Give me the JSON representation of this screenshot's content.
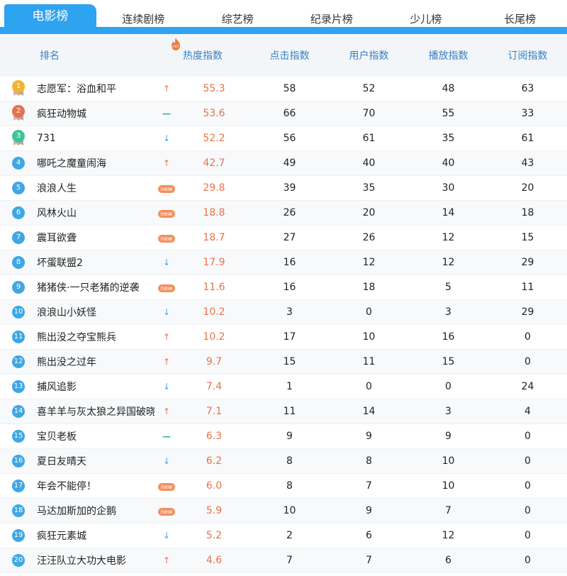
{
  "tabs": [
    {
      "label": "电影榜",
      "active": true
    },
    {
      "label": "连续剧榜",
      "active": false
    },
    {
      "label": "综艺榜",
      "active": false
    },
    {
      "label": "纪录片榜",
      "active": false
    },
    {
      "label": "少儿榜",
      "active": false
    },
    {
      "label": "长尾榜",
      "active": false
    }
  ],
  "header": {
    "rank": "排名",
    "hot_badge": "HOT",
    "heat": "热度指数",
    "click": "点击指数",
    "user": "用户指数",
    "play": "播放指数",
    "subscribe": "订阅指数"
  },
  "new_label": "new",
  "colors": {
    "accent": "#2ea3f0",
    "heat": "#e8734a",
    "badge": "#3fa7e4",
    "gold": "#f2b233",
    "silver_red": "#e8704f",
    "bronze_green": "#3fc39a"
  },
  "rows": [
    {
      "rank": "1",
      "name": "志愿军：浴血和平",
      "trend": "up",
      "heat": "55.3",
      "click": "58",
      "user": "52",
      "play": "48",
      "subscribe": "63"
    },
    {
      "rank": "2",
      "name": "疯狂动物城",
      "trend": "flat",
      "heat": "53.6",
      "click": "66",
      "user": "70",
      "play": "55",
      "subscribe": "33"
    },
    {
      "rank": "3",
      "name": "731",
      "trend": "down",
      "heat": "52.2",
      "click": "56",
      "user": "61",
      "play": "35",
      "subscribe": "61"
    },
    {
      "rank": "4",
      "name": "哪吒之魔童闹海",
      "trend": "up",
      "heat": "42.7",
      "click": "49",
      "user": "40",
      "play": "40",
      "subscribe": "43"
    },
    {
      "rank": "5",
      "name": "浪浪人生",
      "trend": "new",
      "heat": "29.8",
      "click": "39",
      "user": "35",
      "play": "30",
      "subscribe": "20"
    },
    {
      "rank": "6",
      "name": "风林火山",
      "trend": "new",
      "heat": "18.8",
      "click": "26",
      "user": "20",
      "play": "14",
      "subscribe": "18"
    },
    {
      "rank": "7",
      "name": "震耳欲聋",
      "trend": "new",
      "heat": "18.7",
      "click": "27",
      "user": "26",
      "play": "12",
      "subscribe": "15"
    },
    {
      "rank": "8",
      "name": "坏蛋联盟2",
      "trend": "down",
      "heat": "17.9",
      "click": "16",
      "user": "12",
      "play": "12",
      "subscribe": "29"
    },
    {
      "rank": "9",
      "name": "猪猪侠·一只老猪的逆袭",
      "trend": "new",
      "heat": "11.6",
      "click": "16",
      "user": "18",
      "play": "5",
      "subscribe": "11"
    },
    {
      "rank": "10",
      "name": "浪浪山小妖怪",
      "trend": "down",
      "heat": "10.2",
      "click": "3",
      "user": "0",
      "play": "3",
      "subscribe": "29"
    },
    {
      "rank": "11",
      "name": "熊出没之夺宝熊兵",
      "trend": "up",
      "heat": "10.2",
      "click": "17",
      "user": "10",
      "play": "16",
      "subscribe": "0"
    },
    {
      "rank": "12",
      "name": "熊出没之过年",
      "trend": "up",
      "heat": "9.7",
      "click": "15",
      "user": "11",
      "play": "15",
      "subscribe": "0"
    },
    {
      "rank": "13",
      "name": "捕风追影",
      "trend": "down",
      "heat": "7.4",
      "click": "1",
      "user": "0",
      "play": "0",
      "subscribe": "24"
    },
    {
      "rank": "14",
      "name": "喜羊羊与灰太狼之异国破晓",
      "trend": "up",
      "heat": "7.1",
      "click": "11",
      "user": "14",
      "play": "3",
      "subscribe": "4"
    },
    {
      "rank": "15",
      "name": "宝贝老板",
      "trend": "flat",
      "heat": "6.3",
      "click": "9",
      "user": "9",
      "play": "9",
      "subscribe": "0"
    },
    {
      "rank": "16",
      "name": "夏日友晴天",
      "trend": "down",
      "heat": "6.2",
      "click": "8",
      "user": "8",
      "play": "10",
      "subscribe": "0"
    },
    {
      "rank": "17",
      "name": "年会不能停！",
      "trend": "new",
      "heat": "6.0",
      "click": "8",
      "user": "7",
      "play": "10",
      "subscribe": "0"
    },
    {
      "rank": "18",
      "name": "马达加斯加的企鹅",
      "trend": "new",
      "heat": "5.9",
      "click": "10",
      "user": "9",
      "play": "7",
      "subscribe": "0"
    },
    {
      "rank": "19",
      "name": "疯狂元素城",
      "trend": "down",
      "heat": "5.2",
      "click": "2",
      "user": "6",
      "play": "12",
      "subscribe": "0"
    },
    {
      "rank": "20",
      "name": "汪汪队立大功大电影",
      "trend": "up",
      "heat": "4.6",
      "click": "7",
      "user": "7",
      "play": "6",
      "subscribe": "0"
    }
  ]
}
